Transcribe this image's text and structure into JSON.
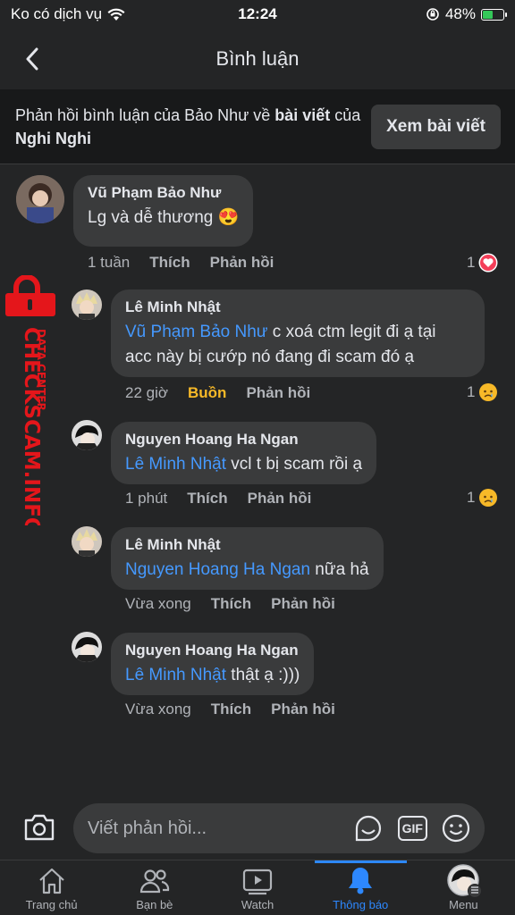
{
  "status": {
    "carrier": "Ko có dịch vụ",
    "time": "12:24",
    "battery": "48%",
    "battery_level": 0.48
  },
  "header": {
    "title": "Bình luận"
  },
  "context": {
    "prefix": "Phản hồi bình luận của Bảo Như về ",
    "bold1": "bài viết",
    "mid": " của ",
    "bold2": "Nghi Nghi",
    "button": "Xem bài viết"
  },
  "watermark": {
    "brand": "CHECKSCAM.INFO",
    "sub": "DATA CENTER"
  },
  "comments": [
    {
      "name": "Vũ Phạm Bảo Như",
      "mention": "",
      "text": "Lg và dễ thương 😍",
      "time": "1 tuần",
      "reaction_label": "Thích",
      "reply": "Phản hồi",
      "react_count": "1",
      "react_icon": "love-icon"
    },
    {
      "name": "Lê Minh Nhật",
      "mention": "Vũ Phạm Bảo Như",
      "text": " c xoá ctm legit đi ạ tại acc này bị cướp nó đang đi scam đó ạ",
      "text_line1": " c xoá ctm legit đi ạ tại",
      "text_line2": "acc này bị cướp nó đang đi scam đó ạ",
      "time": "22 giờ",
      "reaction_label": "Buồn",
      "reply": "Phản hồi",
      "react_count": "1",
      "react_icon": "sad-icon"
    },
    {
      "name": "Nguyen Hoang Ha Ngan",
      "mention": "Lê Minh Nhật",
      "text": " vcl t bị scam rồi ạ",
      "time": "1 phút",
      "reaction_label": "Thích",
      "reply": "Phản hồi",
      "react_count": "1",
      "react_icon": "sad-icon"
    },
    {
      "name": "Lê Minh Nhật",
      "mention": "Nguyen Hoang Ha Ngan",
      "text": " nữa hả",
      "time": "Vừa xong",
      "reaction_label": "Thích",
      "reply": "Phản hồi"
    },
    {
      "name": "Nguyen Hoang Ha Ngan",
      "mention": "Lê Minh Nhật",
      "text": " thật ạ :)))",
      "time": "Vừa xong",
      "reaction_label": "Thích",
      "reply": "Phản hồi"
    }
  ],
  "composer": {
    "placeholder": "Viết phản hồi...",
    "gif": "GIF"
  },
  "tabs": [
    {
      "label": "Trang chủ",
      "icon": "home-icon"
    },
    {
      "label": "Bạn bè",
      "icon": "friends-icon"
    },
    {
      "label": "Watch",
      "icon": "watch-icon"
    },
    {
      "label": "Thông báo",
      "icon": "bell-icon",
      "active": true
    },
    {
      "label": "Menu",
      "icon": "profile-avatar"
    }
  ],
  "colors": {
    "background": "#242526",
    "bubble": "#3a3b3c",
    "mention": "#4599ff",
    "accent": "#2d88ff",
    "sad": "#f7b928",
    "watermark": "#e4161b"
  }
}
